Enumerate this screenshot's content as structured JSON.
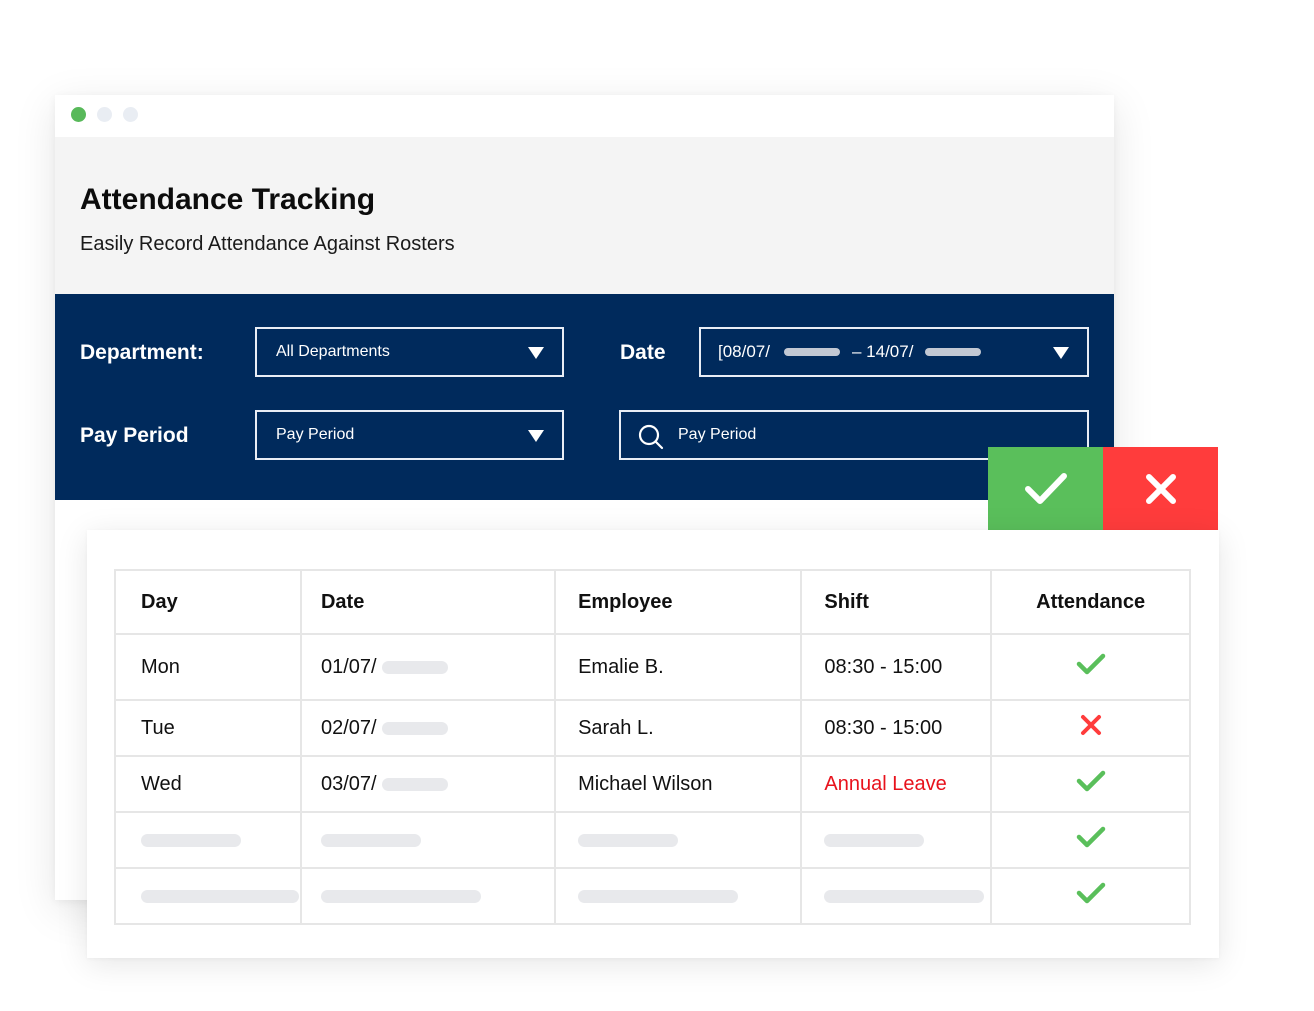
{
  "app": {
    "title": "Attendance Tracking",
    "subtitle": "Easily Record Attendance Against Rosters"
  },
  "filters": {
    "department_label": "Department:",
    "department_value": "All Departments",
    "date_label": "Date",
    "date_start": "[08/07/",
    "date_end": "– 14/07/",
    "pay_period_label": "Pay Period",
    "pay_period_value": "Pay Period",
    "search_placeholder": "Pay Period"
  },
  "actions": {
    "approve_icon": "check-icon",
    "reject_icon": "close-icon",
    "approve_color": "#5abf5b",
    "reject_color": "#ff3c3c"
  },
  "table": {
    "columns": [
      "Day",
      "Date",
      "Employee",
      "Shift",
      "Attendance"
    ],
    "rows": [
      {
        "day": "Mon",
        "date": "01/07/",
        "employee": "Emalie B.",
        "shift": "08:30 - 15:00",
        "attendance": "present"
      },
      {
        "day": "Tue",
        "date": "02/07/",
        "employee": "Sarah L.",
        "shift": "08:30 - 15:00",
        "attendance": "absent"
      },
      {
        "day": "Wed",
        "date": "03/07/",
        "employee": "Michael Wilson",
        "shift": "Annual Leave",
        "attendance": "present"
      },
      {
        "day": "",
        "date": "",
        "employee": "",
        "shift": "",
        "attendance": "present"
      },
      {
        "day": "",
        "date": "",
        "employee": "",
        "shift": "",
        "attendance": "present"
      }
    ]
  },
  "colors": {
    "navy": "#002a5c",
    "present": "#5abf5b",
    "absent": "#ff3c3c",
    "leave_text": "#e8121c"
  }
}
